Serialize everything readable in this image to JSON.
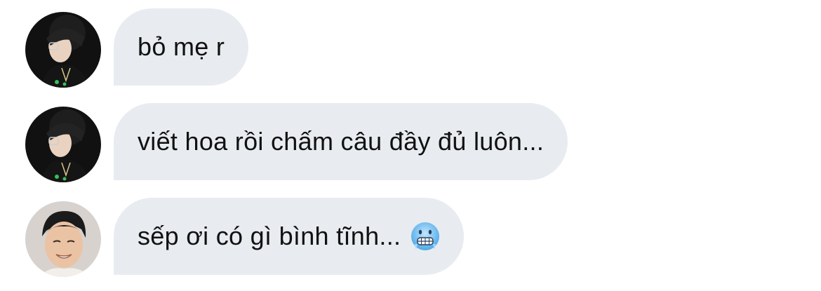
{
  "messages": [
    {
      "text": "bỏ mẹ r",
      "avatar": "avatar-user-a",
      "emoji": ""
    },
    {
      "text": "viết hoa rồi chấm câu đầy đủ luôn...",
      "avatar": "avatar-user-a",
      "emoji": ""
    },
    {
      "text": "sếp ơi có gì bình tĩnh...",
      "avatar": "avatar-user-b",
      "emoji": "cold-face-emoji"
    }
  ],
  "colors": {
    "bubble_background": "#e8ecf0",
    "text": "#111111",
    "page_background": "#ffffff"
  }
}
